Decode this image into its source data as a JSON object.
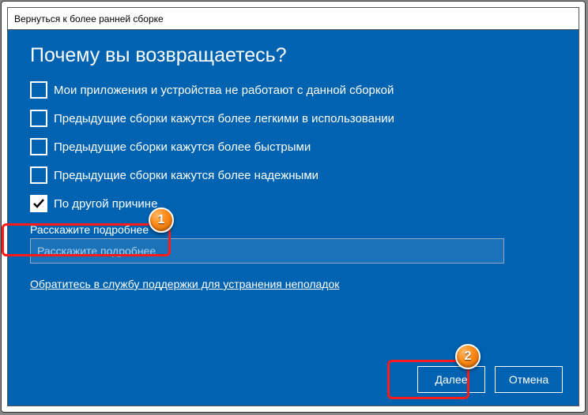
{
  "window": {
    "title": "Вернуться к более ранней сборке"
  },
  "heading": "Почему вы возвращаетесь?",
  "options": [
    {
      "label": "Мои приложения и устройства не работают с данной сборкой",
      "checked": false
    },
    {
      "label": "Предыдущие сборки кажутся более легкими в использовании",
      "checked": false
    },
    {
      "label": "Предыдущие сборки кажутся более быстрыми",
      "checked": false
    },
    {
      "label": "Предыдущие сборки кажутся более надежными",
      "checked": false
    },
    {
      "label": "По другой причине",
      "checked": true
    }
  ],
  "tellmore": {
    "label": "Расскажите подробнее",
    "placeholder": "Расскажите подробнее"
  },
  "support_link": "Обратитесь в службу поддержки для устранения неполадок",
  "buttons": {
    "next": "Далее",
    "cancel": "Отмена"
  },
  "markers": {
    "one": "1",
    "two": "2"
  }
}
